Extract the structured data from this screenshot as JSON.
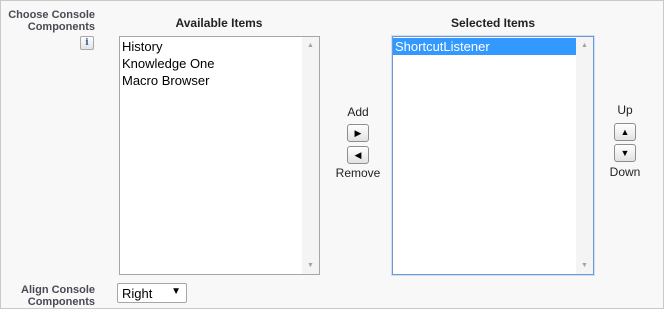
{
  "labels": {
    "choose_console_components": "Choose Console Components",
    "align_console_components": "Align Console Components",
    "info_icon_glyph": "i"
  },
  "available": {
    "title": "Available Items",
    "items": [
      "History",
      "Knowledge One",
      "Macro Browser"
    ]
  },
  "selected": {
    "title": "Selected Items",
    "items": [
      "ShortcutListener"
    ],
    "highlighted_index": 0
  },
  "movers": {
    "add_label": "Add",
    "remove_label": "Remove",
    "up_label": "Up",
    "down_label": "Down"
  },
  "icons": {
    "add": "right-arrow-icon",
    "remove": "left-arrow-icon",
    "up": "up-arrow-icon",
    "down": "down-arrow-icon",
    "info": "info-icon"
  },
  "align": {
    "selected_value": "Right"
  },
  "colors": {
    "selection_highlight": "#3399ff",
    "label_text": "#4a4a56"
  }
}
